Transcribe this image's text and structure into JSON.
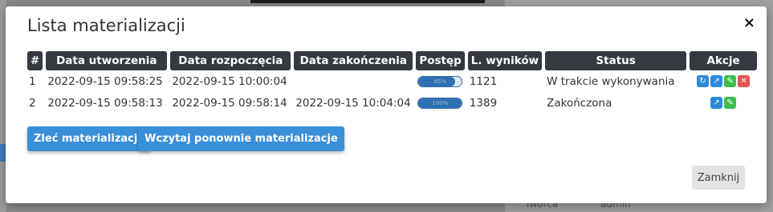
{
  "background": {
    "bottom_right_text_1": "Tworca",
    "bottom_right_text_2": "admin"
  },
  "modal": {
    "title": "Lista materializacji",
    "close_glyph": "×",
    "table": {
      "headers": [
        "#",
        "Data utworzenia",
        "Data rozpoczęcia",
        "Data zakończenia",
        "Postęp",
        "L. wyników",
        "Status",
        "Akcje"
      ],
      "rows": [
        {
          "num": "1",
          "created": "2022-09-15 09:58:25",
          "started": "2022-09-15 10:00:04",
          "finished": "",
          "progress": 0.85,
          "progress_label": "85%",
          "results": "1121",
          "status": "W trakcie wykonywania",
          "actions": [
            "refresh-icon",
            "external-link-icon",
            "edit-icon",
            "delete-icon"
          ]
        },
        {
          "num": "2",
          "created": "2022-09-15 09:58:13",
          "started": "2022-09-15 09:58:14",
          "finished": "2022-09-15 10:04:04",
          "progress": 1.0,
          "progress_label": "100%",
          "results": "1389",
          "status": "Zakończona",
          "actions": [
            "external-link-icon",
            "edit-icon"
          ]
        }
      ]
    },
    "buttons": {
      "order": "Zleć materializację",
      "reload": "Wczytaj ponownie materializacje",
      "close": "Zamknij"
    },
    "colors": {
      "primary": "#3a8fd9",
      "header_bg": "#343a40",
      "action_blue": "#2d8ad8",
      "action_green": "#3cbf4e",
      "action_red": "#e05454"
    }
  }
}
